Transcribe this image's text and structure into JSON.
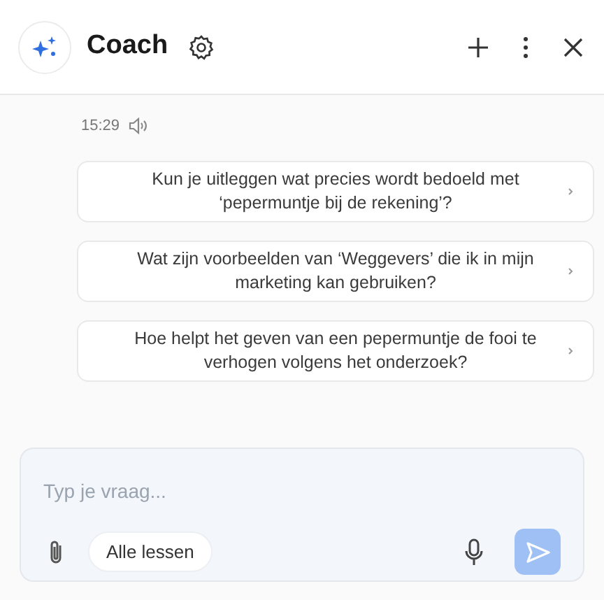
{
  "header": {
    "title": "Coach"
  },
  "message": {
    "time": "15:29"
  },
  "suggestions": [
    {
      "text": "Kun je uitleggen wat precies wordt bedoeld met ‘pepermuntje bij de rekening’?"
    },
    {
      "text": "Wat zijn voorbeelden van ‘Weggevers’ die ik in mijn marketing kan gebruiken?"
    },
    {
      "text": "Hoe helpt het geven van een pepermuntje de fooi te verhogen volgens het onderzoek?"
    }
  ],
  "composer": {
    "placeholder": "Typ je vraag...",
    "scope": "Alle lessen",
    "send_disabled": true
  }
}
